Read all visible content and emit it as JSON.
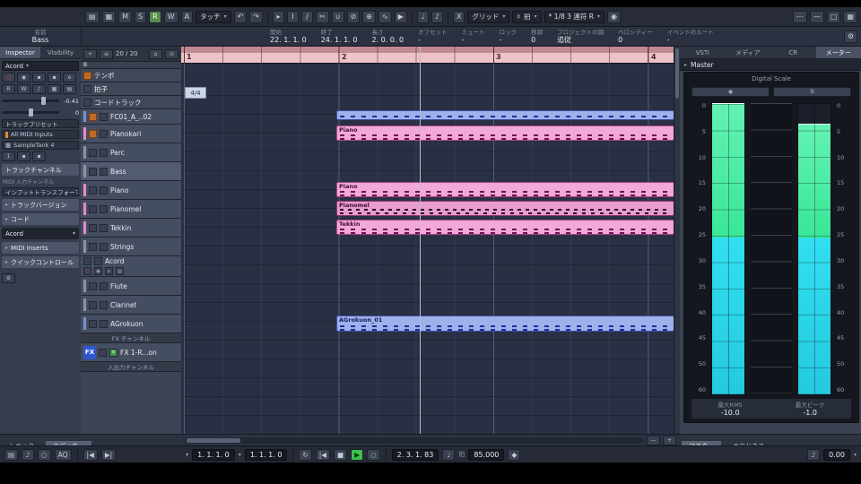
{
  "icons": {
    "hamburger": "≡",
    "grid": "▦",
    "lines": "▤",
    "chev_down": "▾",
    "chev_right": "▸",
    "dots": "⋯",
    "undo": "↶",
    "redo": "↷",
    "tool_select": "▸",
    "tool_range": "I",
    "tool_draw": "∕",
    "tool_split": "✂",
    "tool_mute": "⊘",
    "tool_glue": "∪",
    "tool_zoom": "⊕",
    "tool_line": "∿",
    "tool_play": "▶",
    "metronome": "♩",
    "note": "♪",
    "autoscroll": "X",
    "sharp": "♯",
    "gear": "⚙",
    "home": "⌂",
    "search": "⊙",
    "circle_dot": "◉",
    "play": "▶",
    "stop": "■",
    "record": "○",
    "goto_start": "|◀",
    "goto_end": "▶|",
    "cycle": "↻",
    "diamond": "◆",
    "square": "▪",
    "win_min": "—",
    "win_max": "□",
    "win_close": "×",
    "arrows_ud": "⇅",
    "e_button": "e",
    "plus": "+"
  },
  "toolbar": {
    "automation": [
      "M",
      "S",
      "R",
      "W",
      "A"
    ],
    "mode": "タッチ",
    "grid_label": "グリッド",
    "beat_label": "拍",
    "quantize": "* 1/8 3 連符 R"
  },
  "info": {
    "name_label": "名前",
    "name_value": "Bass",
    "fields": [
      {
        "label": "開始",
        "value": "22. 1. 1. 0"
      },
      {
        "label": "終了",
        "value": "24. 1. 1. 0"
      },
      {
        "label": "長さ",
        "value": "2. 0. 0. 0"
      },
      {
        "label": "オフセット",
        "value": "-"
      },
      {
        "label": "ミュート",
        "value": "-"
      },
      {
        "label": "ロック",
        "value": "-"
      },
      {
        "label": "移調",
        "value": "0"
      },
      {
        "label": "プロジェクトの調",
        "value": "追従"
      },
      {
        "label": "ベロシティー",
        "value": "0"
      },
      {
        "label": "イベントのルート",
        "value": "-"
      }
    ]
  },
  "inspector": {
    "tab_inspector": "Inspector",
    "tab_visibility": "Visibility",
    "chord": "Acord",
    "auto_read": "R",
    "auto_write": "W",
    "volume": "-0.41",
    "pan": "0",
    "preset": "トラックプリセット",
    "input": "All MIDI Inputs",
    "instrument": "SampleTank 4",
    "channel": "1",
    "track_channel": "トラックチャンネル",
    "midi_note": "MIDI 入力チャンネル",
    "input_transformer": "インプットトランスフォーマー",
    "sections": {
      "versions": "トラックバージョン",
      "chords": "コード",
      "chord_combo": "Acord",
      "inserts": "MIDI Inserts",
      "quick": "クイックコントロール"
    }
  },
  "tracklist": {
    "counter": "20 / 20",
    "folder": "B",
    "tempo": "テンポ",
    "signature": "拍子",
    "chord": "コードトラック",
    "tracks": [
      "FC01_A_..02",
      "Pianokari",
      "Perc",
      "Bass",
      "Piano",
      "Pianomel",
      "Tekkin",
      "Strings",
      "Acord",
      "Flute",
      "Clarinet",
      "AGrokuon"
    ],
    "fx_header": "FX チャンネル",
    "fx_badge": "FX",
    "fx_name": "FX 1-R...on",
    "io_header": "入出力チャンネル"
  },
  "arrange": {
    "bars": [
      "1",
      "2",
      "3",
      "4"
    ],
    "signature": "4/4",
    "parts": [
      "",
      "Piano",
      "Piano",
      "Pianomel",
      "Tekkin",
      "AGrokuon_01"
    ]
  },
  "meter": {
    "tabs": [
      "VSTi",
      "メディア",
      "CR",
      "メーター"
    ],
    "master": "Master",
    "scale_label": "Digital Scale",
    "scale": [
      "0",
      "5",
      "10",
      "15",
      "20",
      "25",
      "30",
      "35",
      "40",
      "45",
      "50",
      "60"
    ],
    "rms_label": "最大RMS",
    "rms_value": "-10.0",
    "peak_label": "最大ピーク",
    "peak_value": "-1.0",
    "tab_master": "マスター",
    "tab_loudness": "ラウドネス"
  },
  "bottom_tabs": {
    "track": "トラック",
    "editor": "エディター"
  },
  "transport": {
    "aq": "AQ",
    "left_locator": "1. 1. 1. 0",
    "right_locator": "1. 1. 1. 0",
    "position": "2. 3. 1. 83",
    "tempo": "85.000",
    "beat_mode": "拍",
    "level": "0.00"
  }
}
